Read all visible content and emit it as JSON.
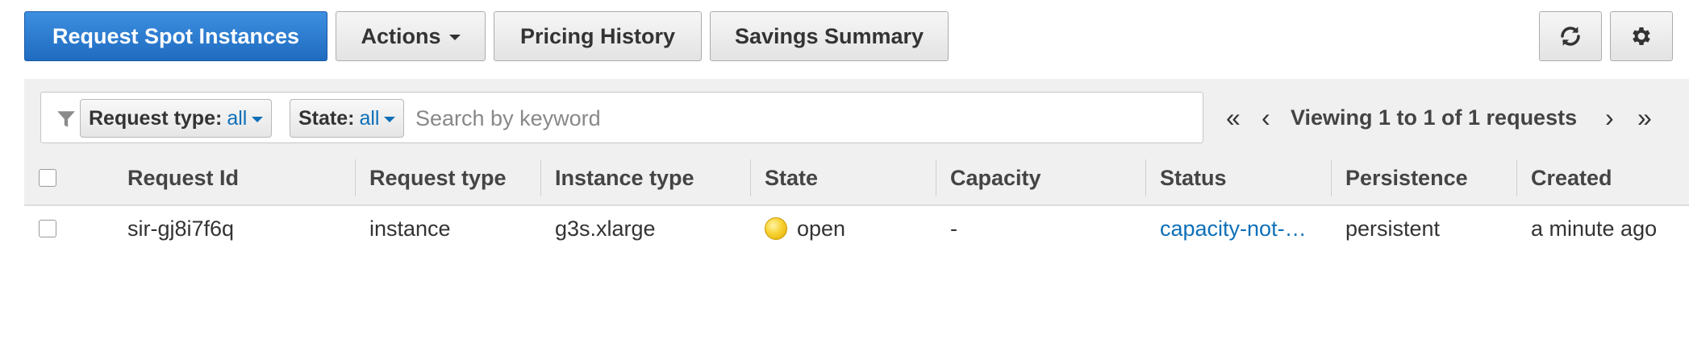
{
  "toolbar": {
    "request_spot_label": "Request Spot Instances",
    "actions_label": "Actions",
    "pricing_history_label": "Pricing History",
    "savings_summary_label": "Savings Summary",
    "refresh_icon": "refresh-icon",
    "settings_icon": "gear-icon",
    "primary_color": "#2a7bd3"
  },
  "filter": {
    "filter_icon": "funnel-icon",
    "request_type_label": "Request type:",
    "request_type_value": "all",
    "state_label": "State:",
    "state_value": "all",
    "search_placeholder": "Search by keyword"
  },
  "pagination": {
    "first_icon": "«",
    "prev_icon": "‹",
    "next_icon": "›",
    "last_icon": "»",
    "summary": "Viewing 1 to 1 of 1 requests"
  },
  "table": {
    "columns": [
      "Request Id",
      "Request type",
      "Instance type",
      "State",
      "Capacity",
      "Status",
      "Persistence",
      "Created"
    ],
    "rows": [
      {
        "request_id": "sir-gj8i7f6q",
        "request_type": "instance",
        "instance_type": "g3s.xlarge",
        "state": "open",
        "state_color": "#f7d232",
        "capacity": "-",
        "status": "capacity-not-…",
        "persistence": "persistent",
        "created": "a minute ago"
      }
    ]
  }
}
